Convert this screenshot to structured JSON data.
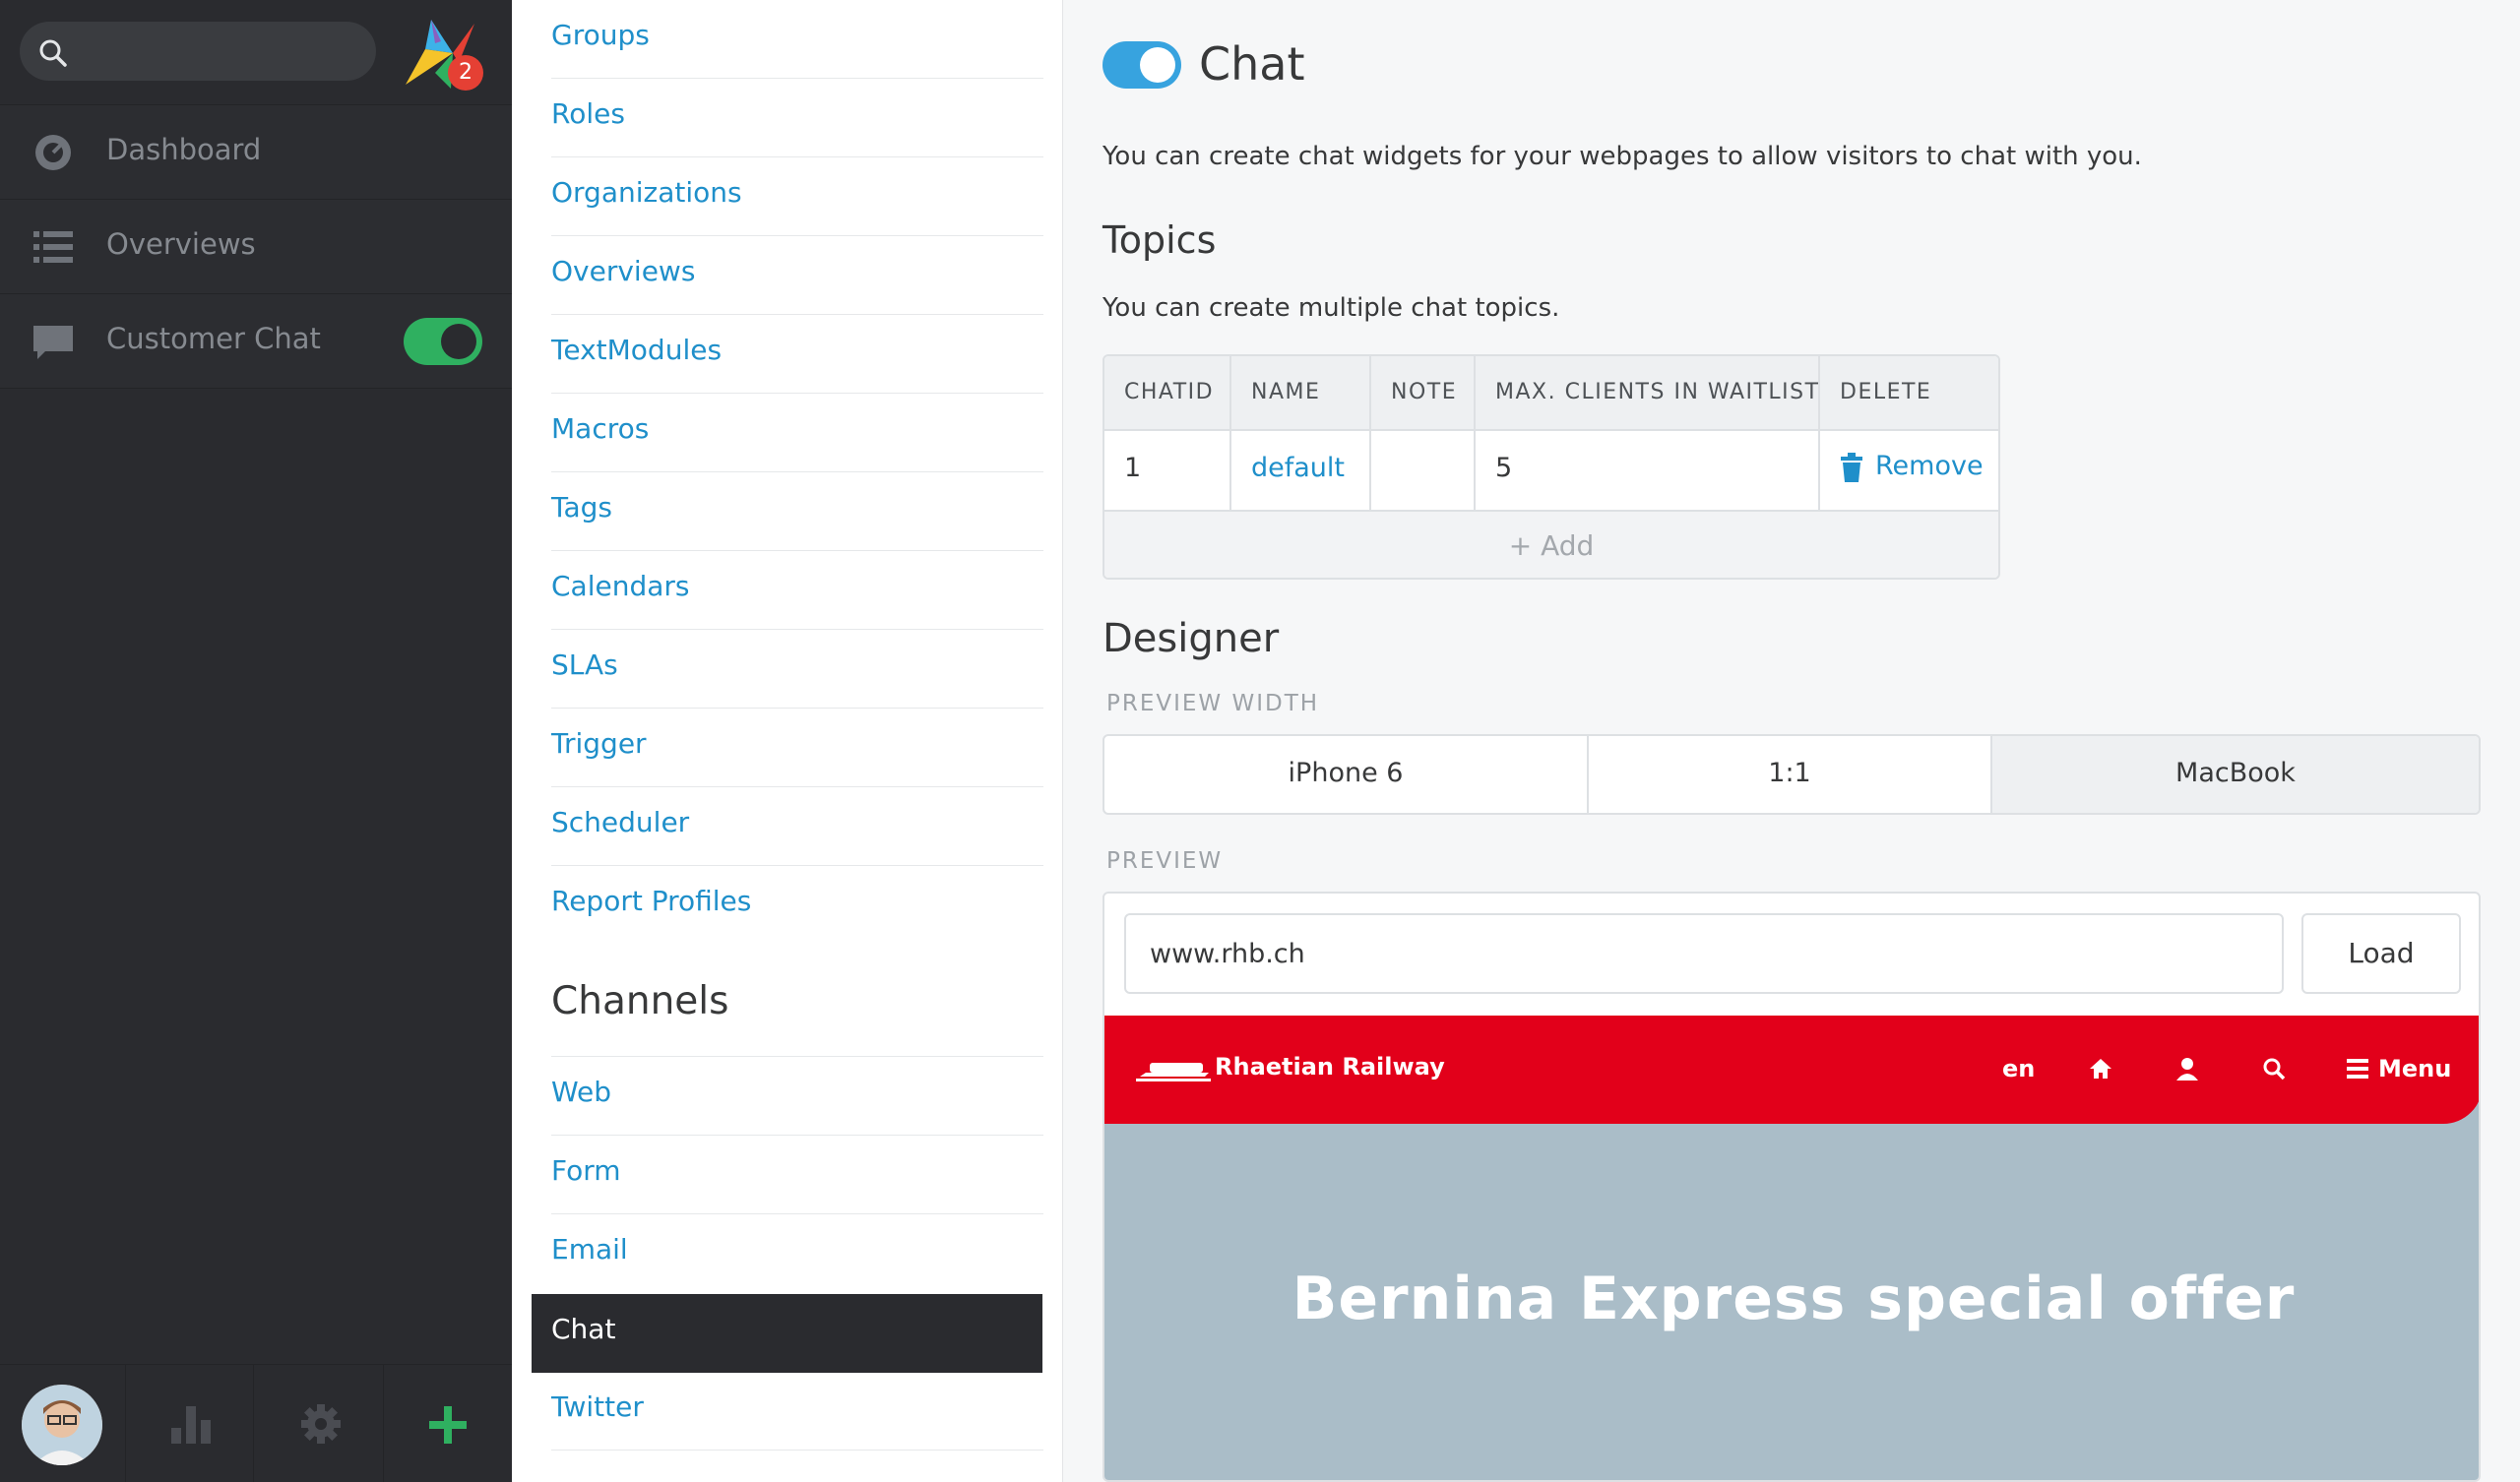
{
  "sidebar": {
    "search_placeholder": "",
    "notification_count": "2",
    "items": [
      {
        "label": "Dashboard",
        "icon": "dashboard-icon"
      },
      {
        "label": "Overviews",
        "icon": "list-icon"
      },
      {
        "label": "Customer Chat",
        "icon": "chat-bubble-icon",
        "toggle": "on"
      }
    ],
    "bottom_icons": [
      "avatar",
      "stats-icon",
      "gear-icon",
      "plus-icon"
    ]
  },
  "settings": {
    "items": [
      "Groups",
      "Roles",
      "Organizations",
      "Overviews",
      "TextModules",
      "Macros",
      "Tags",
      "Calendars",
      "SLAs",
      "Trigger",
      "Scheduler",
      "Report Profiles"
    ],
    "channels_heading": "Channels",
    "channels": [
      "Web",
      "Form",
      "Email",
      "Chat",
      "Twitter"
    ],
    "active": "Chat"
  },
  "main": {
    "title": "Chat",
    "description": "You can create chat widgets for your webpages to allow visitors to chat with you.",
    "topics": {
      "heading": "Topics",
      "description": "You can create multiple chat topics.",
      "columns": [
        "CHATID",
        "NAME",
        "NOTE",
        "MAX. CLIENTS IN WAITLIST",
        "DELETE"
      ],
      "rows": [
        {
          "chatid": "1",
          "name": "default",
          "note": "",
          "max_clients": "5",
          "delete": "Remove"
        }
      ],
      "add_label": "+ Add"
    },
    "designer": {
      "heading": "Designer",
      "preview_width_label": "PREVIEW WIDTH",
      "widths": [
        "iPhone 6",
        "1:1",
        "MacBook"
      ],
      "selected_width": "MacBook",
      "preview_label": "PREVIEW",
      "url_value": "www.rhb.ch",
      "load_label": "Load"
    },
    "site_preview": {
      "brand": "Rhaetian Railway",
      "lang": "en",
      "menu": "Menu",
      "hero": "Bernina Express special offer"
    }
  },
  "colors": {
    "sidebar_bg": "#2a2b2f",
    "link": "#1f8fca",
    "toggle_on": "#37a3df",
    "toggle_green": "#2fb060",
    "site_red": "#e2001a"
  }
}
